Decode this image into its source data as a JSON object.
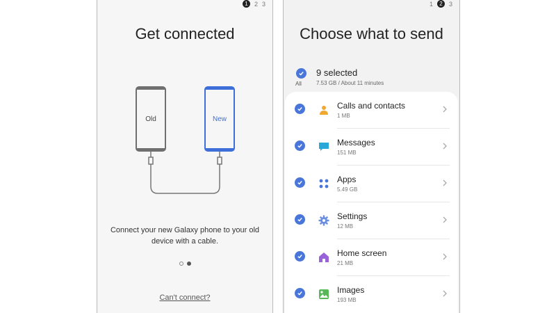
{
  "left": {
    "steps": [
      "1",
      "2",
      "3"
    ],
    "active_step": 0,
    "title": "Get connected",
    "old_label": "Old",
    "new_label": "New",
    "description": "Connect your new Galaxy phone to your old device with a cable.",
    "cant_connect": "Can't connect?"
  },
  "right": {
    "steps": [
      "1",
      "2",
      "3"
    ],
    "active_step": 1,
    "title": "Choose what to send",
    "all_label": "All",
    "selected_text": "9 selected",
    "size_text": "7.53 GB / About 11 minutes",
    "items": [
      {
        "label": "Calls and contacts",
        "size": "1 MB",
        "icon": "contact-icon",
        "color": "#f0a830"
      },
      {
        "label": "Messages",
        "size": "151 MB",
        "icon": "message-icon",
        "color": "#28a8d8"
      },
      {
        "label": "Apps",
        "size": "5.49 GB",
        "icon": "apps-grid-icon",
        "color": "#4a76d9"
      },
      {
        "label": "Settings",
        "size": "12 MB",
        "icon": "gear-icon",
        "color": "#6a8fe0"
      },
      {
        "label": "Home screen",
        "size": "21 MB",
        "icon": "home-icon",
        "color": "#9a62d8"
      },
      {
        "label": "Images",
        "size": "193 MB",
        "icon": "image-icon",
        "color": "#58b858"
      }
    ]
  },
  "colors": {
    "accent": "#4a76d9",
    "new_device": "#3e6fd8"
  }
}
